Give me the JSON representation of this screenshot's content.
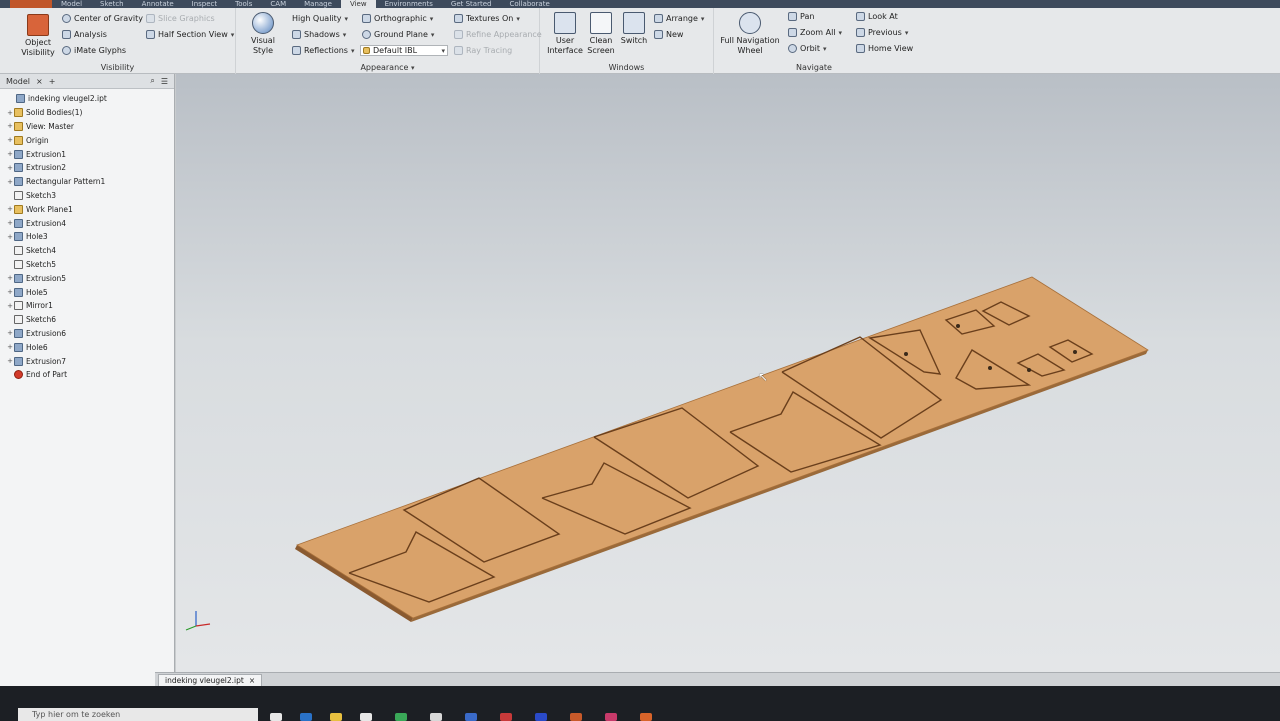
{
  "tabs": [
    {
      "label": "Model"
    },
    {
      "label": "Sketch"
    },
    {
      "label": "Annotate"
    },
    {
      "label": "Inspect"
    },
    {
      "label": "Tools"
    },
    {
      "label": "CAM"
    },
    {
      "label": "Manage"
    },
    {
      "label": "View",
      "active": true
    },
    {
      "label": "Environments"
    },
    {
      "label": "Get Started"
    },
    {
      "label": "Collaborate"
    }
  ],
  "ribbon": {
    "visibility": {
      "title": "Visibility",
      "object_visibility": "Object\nVisibility",
      "center_of_gravity": "Center of Gravity",
      "slice_graphics": "Slice Graphics",
      "analysis": "Analysis",
      "half_section_view": "Half Section View",
      "imate_glyphs": "iMate Glyphs"
    },
    "appearance": {
      "title": "Appearance",
      "visual_style": "Visual Style",
      "high_quality": "High Quality",
      "shadows": "Shadows",
      "reflections": "Reflections",
      "orthographic": "Orthographic",
      "ground_plane": "Ground Plane",
      "default_ibl": "Default IBL",
      "textures_on": "Textures On",
      "refine_appearance": "Refine Appearance",
      "ray_tracing": "Ray Tracing"
    },
    "windows": {
      "title": "Windows",
      "user_interface": "User\nInterface",
      "clean_screen": "Clean\nScreen",
      "switch": "Switch",
      "arrange": "Arrange",
      "new": "New"
    },
    "navigate": {
      "title": "Navigate",
      "full_navigation_wheel": "Full Navigation\nWheel",
      "pan": "Pan",
      "zoom_all": "Zoom All",
      "orbit": "Orbit",
      "look_at": "Look At",
      "previous": "Previous",
      "home_view": "Home View"
    }
  },
  "browser": {
    "tab_label": "Model",
    "items": [
      {
        "label": "indeking vleugel2.ipt",
        "icon": "part-icon",
        "expand": ""
      },
      {
        "label": "Solid Bodies(1)",
        "icon": "folder-icon",
        "expand": "+"
      },
      {
        "label": "View: Master",
        "icon": "folder-icon",
        "expand": "+"
      },
      {
        "label": "Origin",
        "icon": "folder-icon",
        "expand": "+"
      },
      {
        "label": "Extrusion1",
        "icon": "extrusion-icon",
        "expand": "+"
      },
      {
        "label": "Extrusion2",
        "icon": "extrusion-icon",
        "expand": "+"
      },
      {
        "label": "Rectangular Pattern1",
        "icon": "pattern-icon",
        "expand": "+"
      },
      {
        "label": "Sketch3",
        "icon": "sketch-icon",
        "expand": ""
      },
      {
        "label": "Work Plane1",
        "icon": "workplane-icon",
        "expand": "+"
      },
      {
        "label": "Extrusion4",
        "icon": "extrusion-icon",
        "expand": "+"
      },
      {
        "label": "Hole3",
        "icon": "hole-icon",
        "expand": "+"
      },
      {
        "label": "Sketch4",
        "icon": "sketch-icon",
        "expand": ""
      },
      {
        "label": "Sketch5",
        "icon": "sketch-icon",
        "expand": ""
      },
      {
        "label": "Extrusion5",
        "icon": "extrusion-icon",
        "expand": "+"
      },
      {
        "label": "Hole5",
        "icon": "hole-icon",
        "expand": "+"
      },
      {
        "label": "Mirror1",
        "icon": "mirror-icon",
        "expand": "+"
      },
      {
        "label": "Sketch6",
        "icon": "sketch-icon",
        "expand": ""
      },
      {
        "label": "Extrusion6",
        "icon": "extrusion-icon",
        "expand": "+"
      },
      {
        "label": "Hole6",
        "icon": "hole-icon",
        "expand": "+"
      },
      {
        "label": "Extrusion7",
        "icon": "extrusion-icon",
        "expand": "+"
      },
      {
        "label": "End of Part",
        "icon": "end-of-part-icon",
        "expand": ""
      }
    ]
  },
  "document_tab": {
    "label": "indeking vleugel2.ipt",
    "close": "×"
  },
  "taskbar": {
    "search_placeholder": "Typ hier om te zoeken"
  },
  "colors": {
    "plate": "#d9a26a",
    "plate_edge": "#8a5a30",
    "ribbon": "#e6e8ea",
    "accent": "#3d4a5c"
  }
}
